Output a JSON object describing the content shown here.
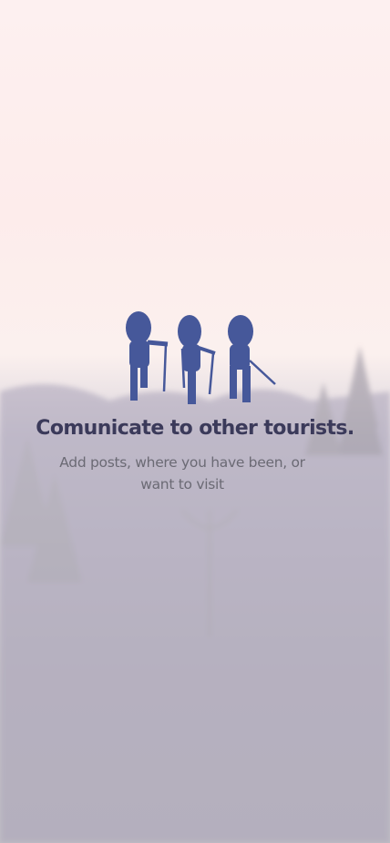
{
  "onboarding": {
    "title": "Comunicate to other tourists.",
    "subtitle": "Add posts, where you have been, or want to visit",
    "illustration": "hikers-icon",
    "accent_color": "#46589a",
    "title_color": "#3b3a5a"
  }
}
